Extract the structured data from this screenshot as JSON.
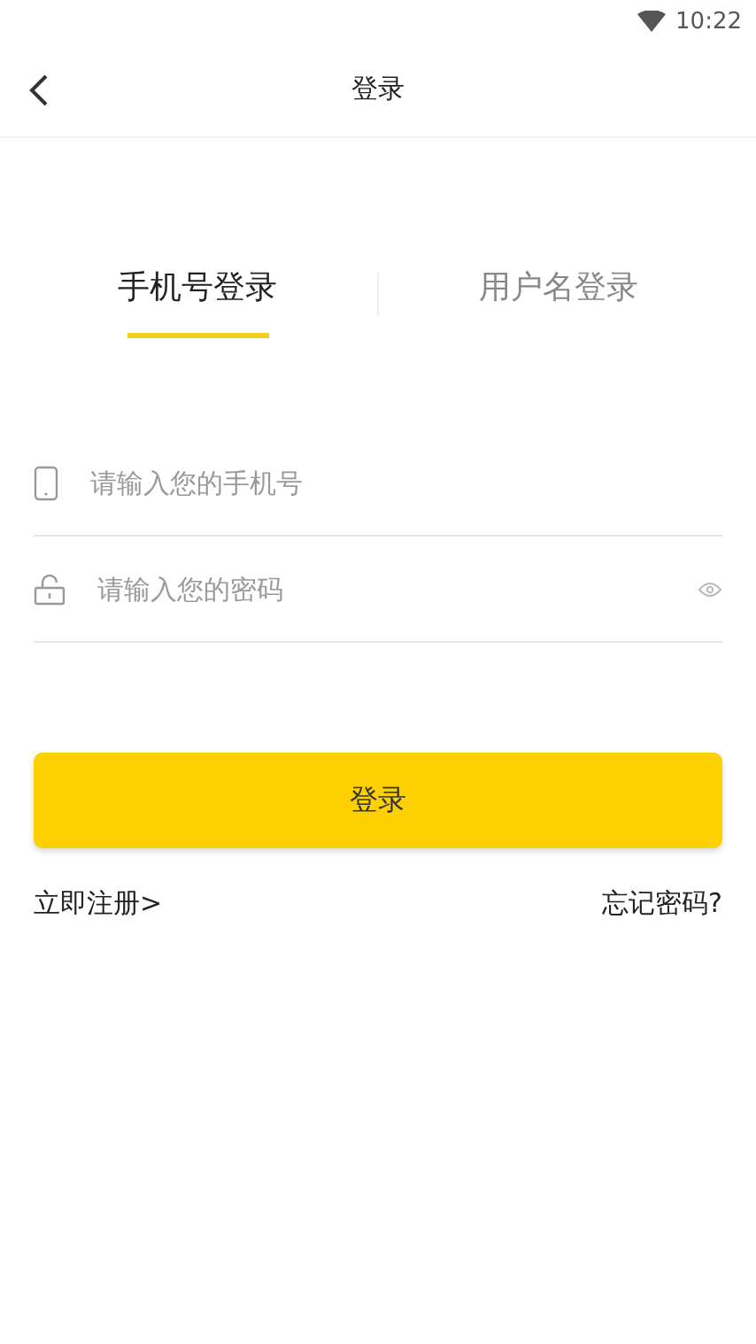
{
  "status_bar": {
    "time": "10:22"
  },
  "nav": {
    "title": "登录"
  },
  "tabs": [
    {
      "label": "手机号登录",
      "selected": true
    },
    {
      "label": "用户名登录",
      "selected": false
    }
  ],
  "fields": [
    {
      "kind": "phone",
      "placeholder": "请输入您的手机号"
    },
    {
      "kind": "password",
      "placeholder": "请输入您的密码"
    }
  ],
  "submit": "登录",
  "links": {
    "register": "立即注册>",
    "forgot": "忘记密码?"
  }
}
